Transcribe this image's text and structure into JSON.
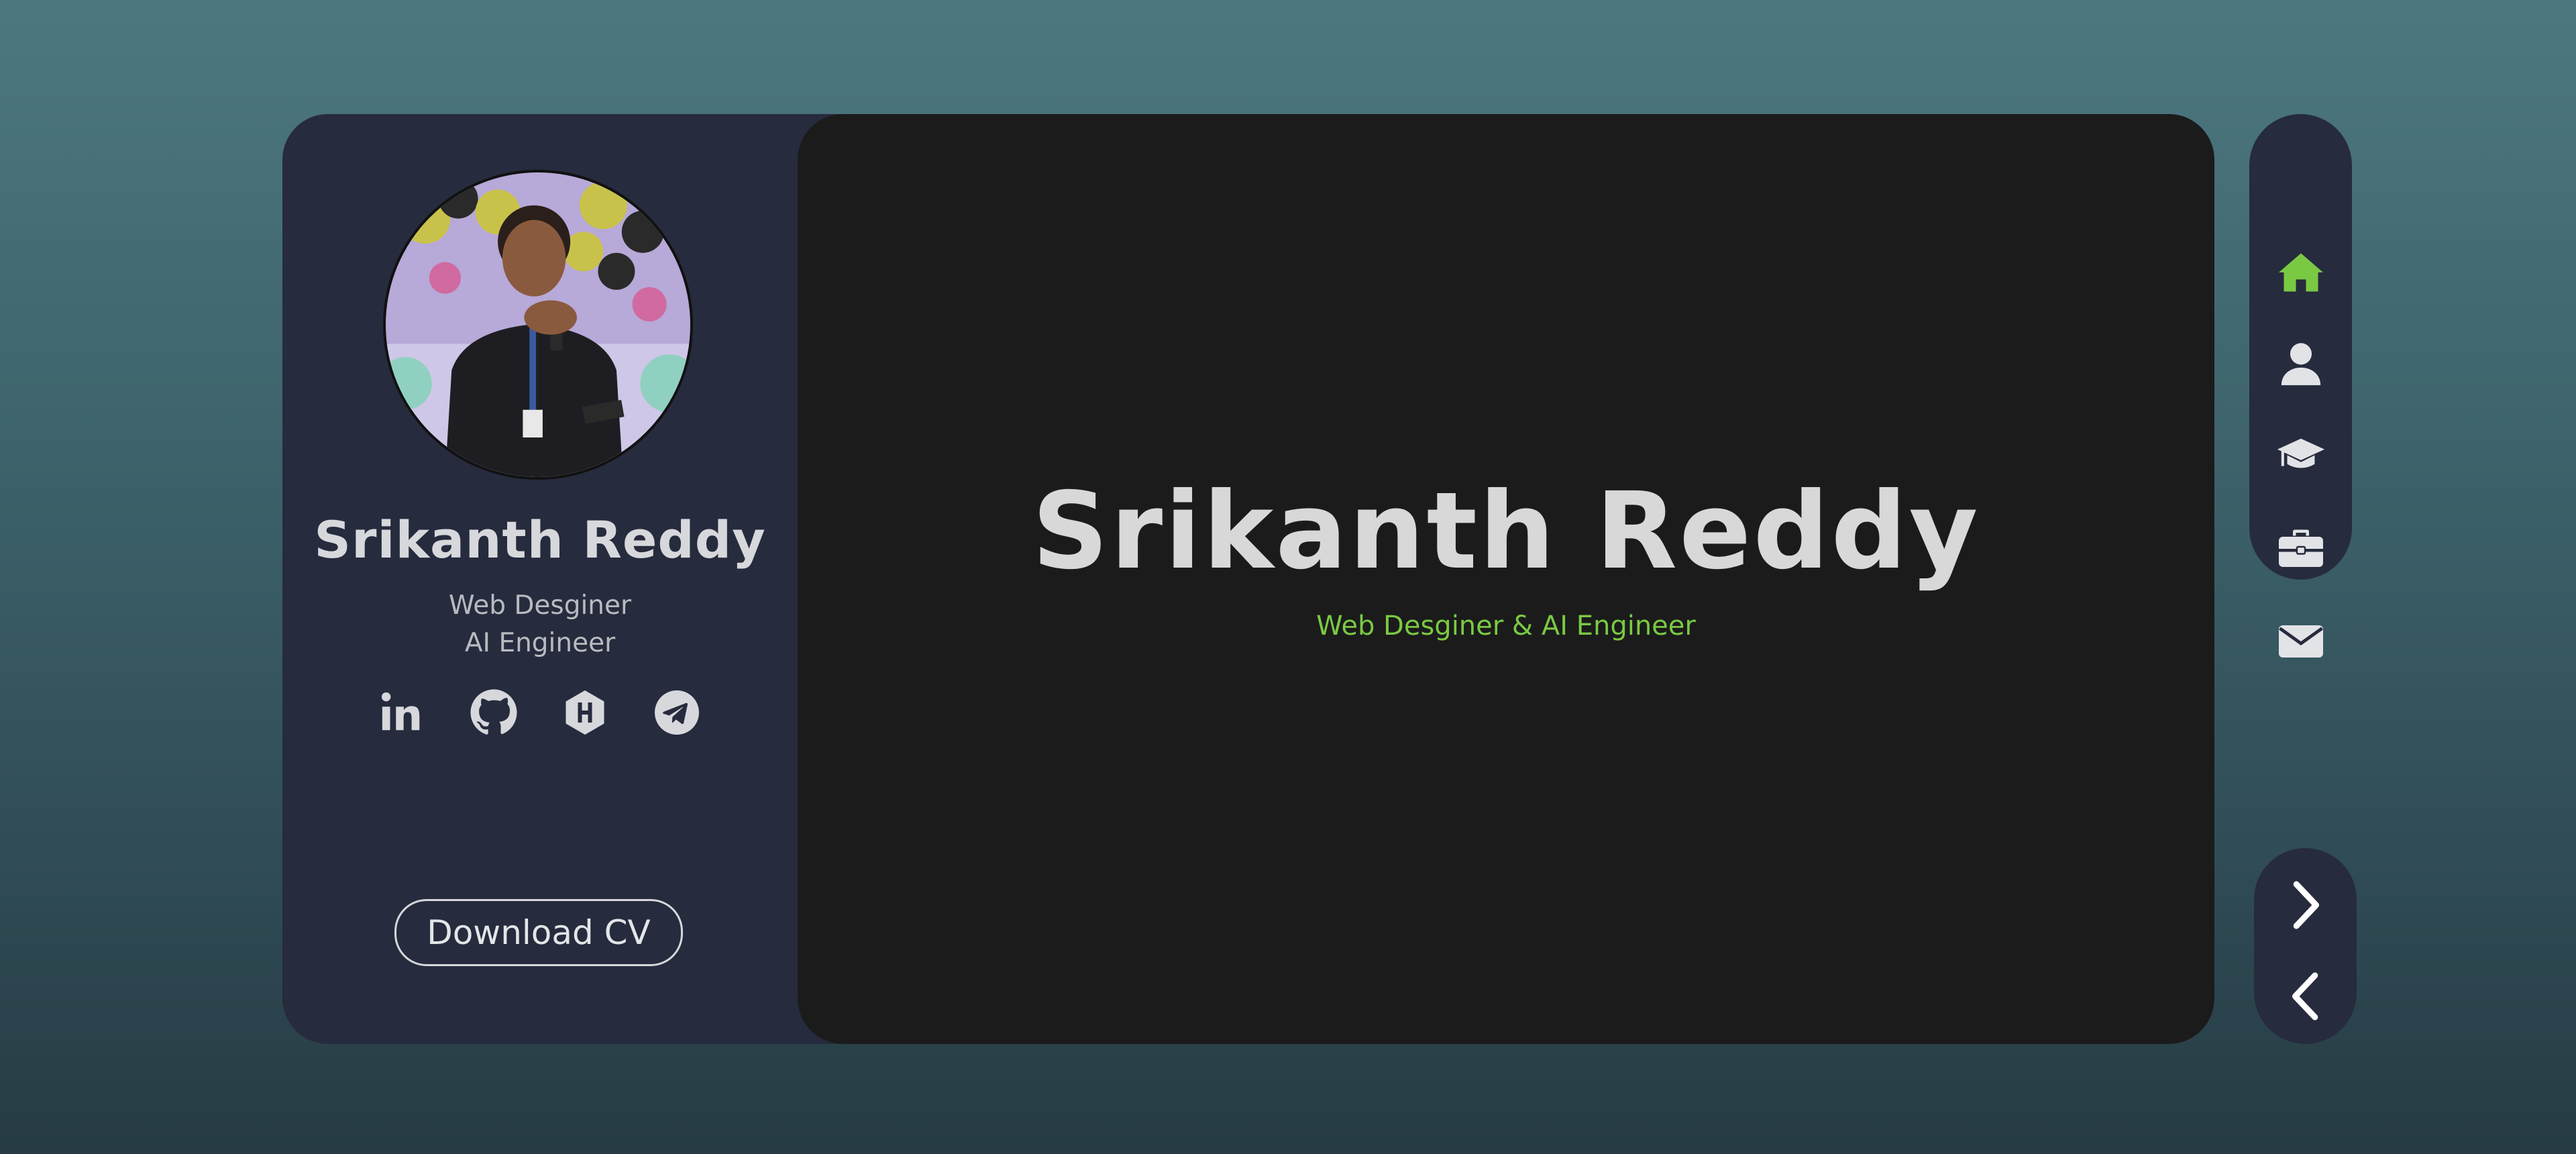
{
  "profile": {
    "name": "Srikanth Reddy",
    "role_line1": "Web Desginer",
    "role_line2": "AI Engineer",
    "download_label": "Download CV",
    "socials": [
      "linkedin-icon",
      "github-icon",
      "hashnode-icon",
      "telegram-icon"
    ]
  },
  "hero": {
    "name": "Srikanth Reddy",
    "subtitle": "Web Desginer & AI Engineer"
  },
  "nav": {
    "items": [
      "home-icon",
      "user-icon",
      "graduation-cap-icon",
      "briefcase-icon",
      "envelope-icon"
    ],
    "active": "home-icon"
  },
  "pager": {
    "items": [
      "chevron-right-icon",
      "chevron-left-icon"
    ]
  },
  "colors": {
    "accent": "#7ac943",
    "panel": "#262b3d",
    "main": "#1b1b1b",
    "text": "#d8d8d8"
  }
}
